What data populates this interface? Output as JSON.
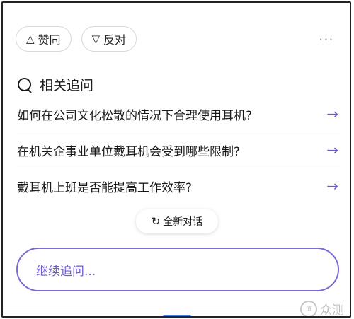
{
  "vote": {
    "like_label": "赞同",
    "dislike_label": "反对",
    "like_icon": "△",
    "dislike_icon": "▽"
  },
  "more_icon": "···",
  "related": {
    "title": "相关追问",
    "items": [
      {
        "text": "如何在公司文化松散的情况下合理使用耳机?",
        "arrow": "→"
      },
      {
        "text": "在机关企事业单位戴耳机会受到哪些限制?",
        "arrow": "→"
      },
      {
        "text": "戴耳机上班是否能提高工作效率?",
        "arrow": "→"
      }
    ]
  },
  "new_chat": {
    "icon": "↻",
    "label": "全新对话"
  },
  "input": {
    "placeholder": "继续追问..."
  },
  "watermark": {
    "logo_text": "值",
    "text": "众测"
  },
  "colors": {
    "accent": "#6d59c9",
    "border_accent": "#7c69d6",
    "tab_blue": "#3f7be0"
  }
}
